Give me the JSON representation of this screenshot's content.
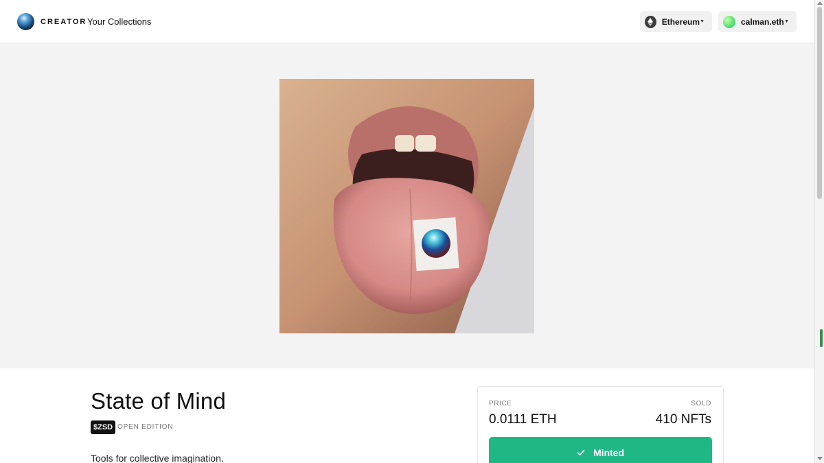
{
  "header": {
    "brand": "CREATOR",
    "nav_link": "Your Collections",
    "network": {
      "label": "Ethereum",
      "icon": "ethereum-icon"
    },
    "account": {
      "label": "calman.eth",
      "icon": "avatar-gradient"
    }
  },
  "artwork": {
    "description_icon": "tongue-with-orb-artwork"
  },
  "token": {
    "title": "State of Mind",
    "symbol": "$ZSD",
    "edition": "OPEN EDITION",
    "description": "Tools for collective imagination."
  },
  "sale": {
    "price_label": "PRICE",
    "price_value": "0.0111 ETH",
    "sold_label": "SOLD",
    "sold_value": "410 NFTs",
    "action_label": "Minted"
  },
  "colors": {
    "accent": "#1fb884",
    "hero_background": "#f3f3f3",
    "badge": "#111111"
  }
}
